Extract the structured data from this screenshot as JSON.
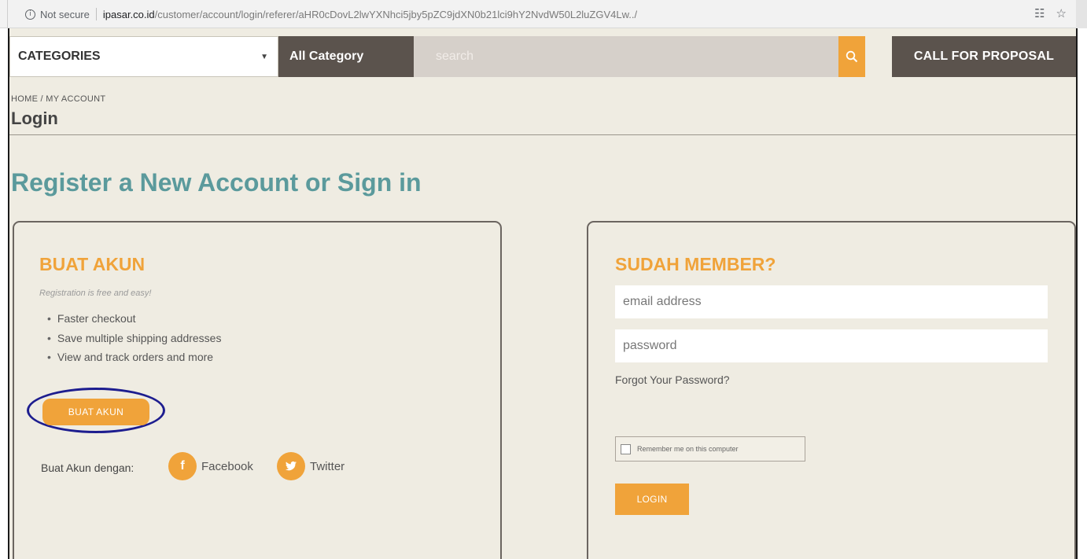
{
  "browser": {
    "not_secure": "Not secure",
    "url_host": "ipasar.co.id",
    "url_path": "/customer/account/login/referer/aHR0cDovL2lwYXNhci5jby5pZC9jdXN0b21lci9hY2NvdW50L2luZGV4Lw../"
  },
  "nav": {
    "categories_label": "CATEGORIES",
    "all_category": "All Category",
    "search_placeholder": "search",
    "call_for_proposal": "CALL FOR PROPOSAL"
  },
  "breadcrumb": "HOME / MY ACCOUNT",
  "page_title": "Login",
  "main_heading": "Register a New Account or Sign in",
  "register": {
    "heading": "BUAT AKUN",
    "note": "Registration is free and easy!",
    "benefits": [
      "Faster checkout",
      "Save multiple shipping addresses",
      "View and track orders and more"
    ],
    "button": "BUAT AKUN",
    "social_label": "Buat Akun dengan:",
    "facebook": "Facebook",
    "twitter": "Twitter"
  },
  "login": {
    "heading": "SUDAH MEMBER?",
    "email_placeholder": "email address",
    "password_placeholder": "password",
    "forgot": "Forgot Your Password?",
    "remember": "Remember me on this computer",
    "button": "LOGIN"
  },
  "colors": {
    "accent_orange": "#f0a33a",
    "heading_teal": "#5b9a9c",
    "dark_nav": "#5b534d",
    "page_bg": "#efece2",
    "highlight_ring": "#1d1d8f"
  }
}
